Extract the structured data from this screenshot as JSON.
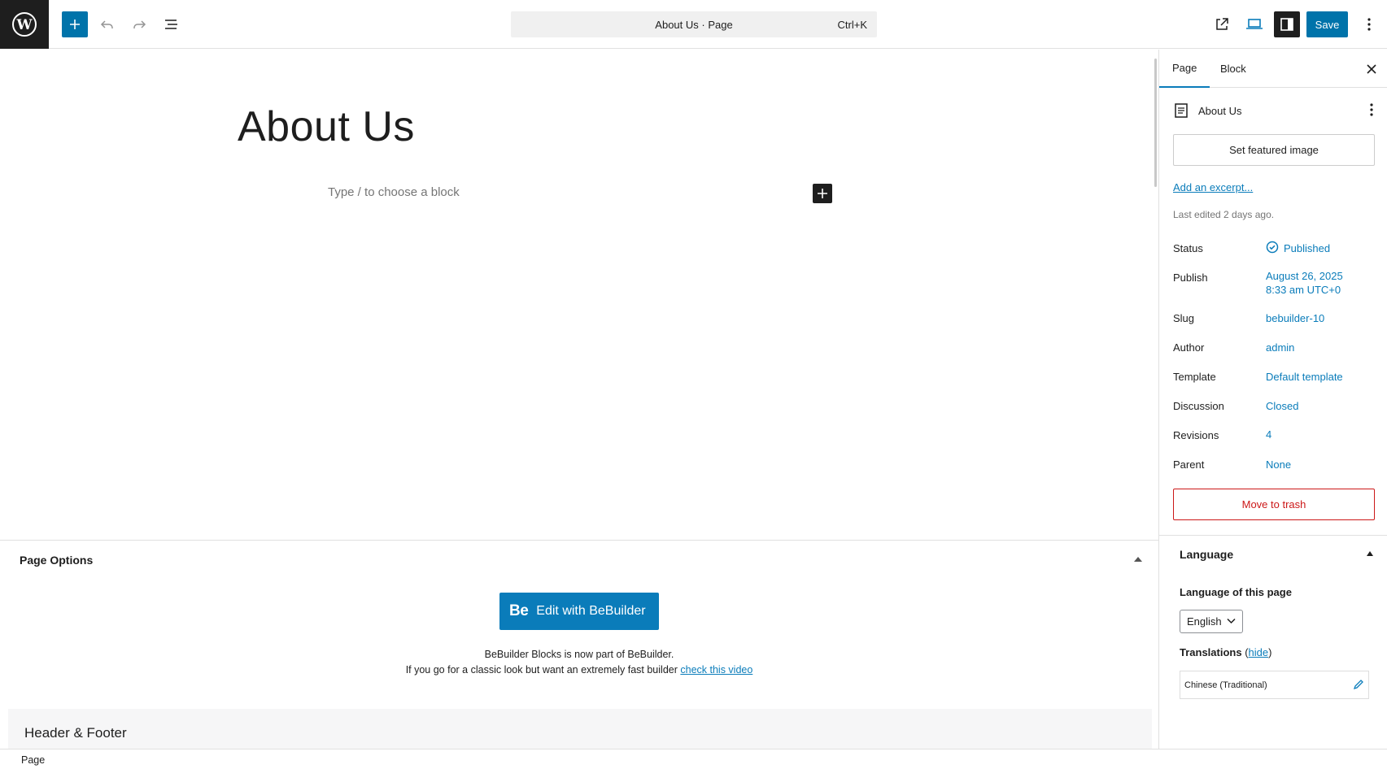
{
  "topbar": {
    "document_title": "About Us · Page",
    "shortcut": "Ctrl+K",
    "save_label": "Save",
    "icons": [
      "wordpress-logo",
      "plus-icon",
      "undo-icon",
      "redo-icon",
      "list-view-icon",
      "external-link-icon",
      "desktop-view-icon",
      "sidebar-toggle-icon",
      "more-vertical-icon"
    ],
    "accent_color": "#0073aa"
  },
  "editor": {
    "title": "About Us",
    "placeholder": "Type / to choose a block"
  },
  "metabox": {
    "title": "Page Options",
    "bebuilder_logo": "Be",
    "bebuilder_button": "Edit with BeBuilder",
    "info_line1": "BeBuilder Blocks is now part of BeBuilder.",
    "info_line2": "If you go for a classic look but want an extremely fast builder",
    "info_link": "check this video",
    "header_footer_title": "Header & Footer"
  },
  "footer": {
    "breadcrumb": "Page"
  },
  "sidebar": {
    "tabs": [
      {
        "label": "Page"
      },
      {
        "label": "Block"
      }
    ],
    "active_tab": "Page",
    "document_title": "About Us",
    "featured_image_label": "Set featured image",
    "excerpt_link": "Add an excerpt...",
    "last_edited": "Last edited 2 days ago.",
    "rows": [
      {
        "label": "Status",
        "value": "Published"
      },
      {
        "label": "Publish",
        "value": "August 26, 2025",
        "value2": "8:33 am UTC+0"
      },
      {
        "label": "Slug",
        "value": "bebuilder-10"
      },
      {
        "label": "Author",
        "value": "admin"
      },
      {
        "label": "Template",
        "value": "Default template"
      },
      {
        "label": "Discussion",
        "value": "Closed"
      },
      {
        "label": "Revisions",
        "value": "4"
      },
      {
        "label": "Parent",
        "value": "None"
      }
    ],
    "trash_label": "Move to trash",
    "trash_color": "#cc1818"
  },
  "language": {
    "title": "Language",
    "page_language_label": "Language of this page",
    "selected_language": "English",
    "translations_label": "Translations",
    "hide_link": "hide",
    "open_paren": "(",
    "close_paren": ")",
    "translation_item": "Chinese (Traditional)"
  }
}
